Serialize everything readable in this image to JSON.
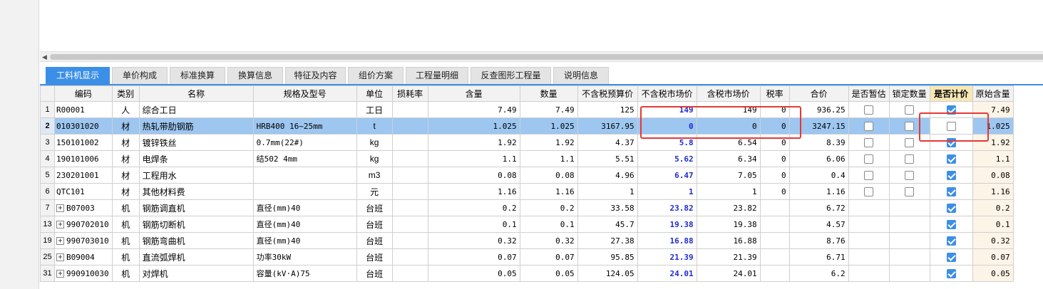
{
  "tabs": [
    {
      "label": "工料机显示"
    },
    {
      "label": "单价构成"
    },
    {
      "label": "标准换算"
    },
    {
      "label": "换算信息"
    },
    {
      "label": "特征及内容"
    },
    {
      "label": "组价方案"
    },
    {
      "label": "工程量明细"
    },
    {
      "label": "反查图形工程量"
    },
    {
      "label": "说明信息"
    }
  ],
  "active_tab": "工料机显示",
  "columns": [
    "编码",
    "类别",
    "名称",
    "规格及型号",
    "单位",
    "损耗率",
    "含量",
    "数量",
    "不含税预算价",
    "不含税市场价",
    "含税市场价",
    "税率",
    "合价",
    "是否暂估",
    "锁定数量",
    "是否计价",
    "原始含量"
  ],
  "highlighted_column": "是否计价",
  "rows": [
    {
      "rn": "1",
      "expand": false,
      "code": "R00001",
      "type": "人",
      "name": "综合工日",
      "spec": "",
      "unit": "工日",
      "loss": "",
      "content": "7.49",
      "qty": "7.49",
      "budget": "125",
      "market": "149",
      "market_tax": "149",
      "tax": "0",
      "total": "936.25",
      "est": false,
      "lock": false,
      "priced": true,
      "orig": "7.49"
    },
    {
      "rn": "2",
      "expand": false,
      "code": "010301020",
      "type": "材",
      "name": "热轧带肋钢筋",
      "spec": "HRB400 16~25mm",
      "unit": "t",
      "loss": "",
      "content": "1.025",
      "qty": "1.025",
      "budget": "3167.95",
      "market": "0",
      "market_tax": "0",
      "tax": "0",
      "total": "3247.15",
      "est": false,
      "lock": false,
      "priced": false,
      "orig": "1.025"
    },
    {
      "rn": "3",
      "expand": false,
      "code": "150101002",
      "type": "材",
      "name": "镀锌铁丝",
      "spec": "0.7mm(22#)",
      "unit": "kg",
      "loss": "",
      "content": "1.92",
      "qty": "1.92",
      "budget": "4.37",
      "market": "5.8",
      "market_tax": "6.54",
      "tax": "0",
      "total": "8.39",
      "est": false,
      "lock": false,
      "priced": true,
      "orig": "1.92"
    },
    {
      "rn": "4",
      "expand": false,
      "code": "190101006",
      "type": "材",
      "name": "电焊条",
      "spec": "结502 4mm",
      "unit": "kg",
      "loss": "",
      "content": "1.1",
      "qty": "1.1",
      "budget": "5.51",
      "market": "5.62",
      "market_tax": "6.34",
      "tax": "0",
      "total": "6.06",
      "est": false,
      "lock": false,
      "priced": true,
      "orig": "1.1"
    },
    {
      "rn": "5",
      "expand": false,
      "code": "230201001",
      "type": "材",
      "name": "工程用水",
      "spec": "",
      "unit": "m3",
      "loss": "",
      "content": "0.08",
      "qty": "0.08",
      "budget": "4.96",
      "market": "6.47",
      "market_tax": "7.05",
      "tax": "0",
      "total": "0.4",
      "est": false,
      "lock": false,
      "priced": true,
      "orig": "0.08"
    },
    {
      "rn": "6",
      "expand": false,
      "code": "QTC101",
      "type": "材",
      "name": "其他材料费",
      "spec": "",
      "unit": "元",
      "loss": "",
      "content": "1.16",
      "qty": "1.16",
      "budget": "1",
      "market": "1",
      "market_tax": "1",
      "tax": "0",
      "total": "1.16",
      "est": false,
      "lock": false,
      "priced": true,
      "orig": "1.16"
    },
    {
      "rn": "7",
      "expand": true,
      "code": "B07003",
      "type": "机",
      "name": "钢筋调直机",
      "spec": "直径(mm)40",
      "unit": "台班",
      "loss": "",
      "content": "0.2",
      "qty": "0.2",
      "budget": "33.58",
      "market": "23.82",
      "market_tax": "23.82",
      "tax": "",
      "total": "6.72",
      "est": null,
      "lock": null,
      "priced": true,
      "orig": "0.2"
    },
    {
      "rn": "13",
      "expand": true,
      "code": "990702010",
      "type": "机",
      "name": "钢筋切断机",
      "spec": "直径(mm)40",
      "unit": "台班",
      "loss": "",
      "content": "0.1",
      "qty": "0.1",
      "budget": "45.7",
      "market": "19.38",
      "market_tax": "19.38",
      "tax": "",
      "total": "4.57",
      "est": null,
      "lock": null,
      "priced": true,
      "orig": "0.1"
    },
    {
      "rn": "19",
      "expand": true,
      "code": "990703010",
      "type": "机",
      "name": "钢筋弯曲机",
      "spec": "直径(mm)40",
      "unit": "台班",
      "loss": "",
      "content": "0.32",
      "qty": "0.32",
      "budget": "27.38",
      "market": "16.88",
      "market_tax": "16.88",
      "tax": "",
      "total": "8.76",
      "est": null,
      "lock": null,
      "priced": true,
      "orig": "0.32"
    },
    {
      "rn": "25",
      "expand": true,
      "code": "B09004",
      "type": "机",
      "name": "直流弧焊机",
      "spec": "功率30kW",
      "unit": "台班",
      "loss": "",
      "content": "0.07",
      "qty": "0.07",
      "budget": "95.85",
      "market": "21.39",
      "market_tax": "21.39",
      "tax": "",
      "total": "6.71",
      "est": null,
      "lock": null,
      "priced": true,
      "orig": "0.07"
    },
    {
      "rn": "31",
      "expand": true,
      "code": "990910030",
      "type": "机",
      "name": "对焊机",
      "spec": "容量(kV·A)75",
      "unit": "台班",
      "loss": "",
      "content": "0.05",
      "qty": "0.05",
      "budget": "124.05",
      "market": "24.01",
      "market_tax": "24.01",
      "tax": "",
      "total": "6.2",
      "est": null,
      "lock": null,
      "priced": true,
      "orig": "0.05"
    }
  ],
  "colors": {
    "accent": "#3b8fe6",
    "highlight_header": "#f7e7b4",
    "selected_row": "#9dc6f0",
    "market_text": "#1f2bd1",
    "annotation_red": "#e53935"
  }
}
